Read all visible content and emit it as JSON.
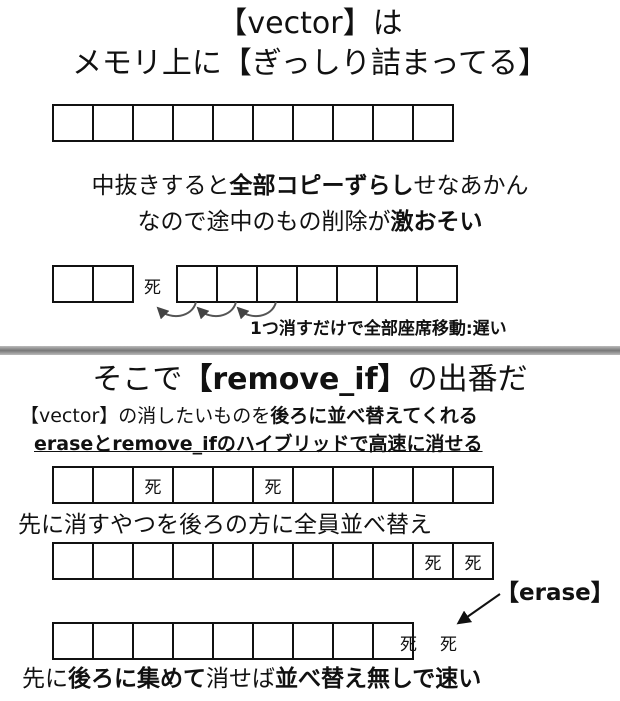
{
  "top": {
    "title_line1": "【vector】は",
    "title_line2": "メモリ上に【ぎっしり詰まってる】",
    "desc1": {
      "a": "中抜きすると",
      "b": "全部コピーずらし",
      "c": "せなあかん"
    },
    "desc2": {
      "a": "なので途中のもの削除が",
      "b": "激おそい"
    },
    "dead_mark": "死",
    "shift_note": "1つ消すだけで全部座席移動:遅い"
  },
  "bottom": {
    "title": {
      "a": "そこで",
      "b": "【remove_if】",
      "c": "の出番だ"
    },
    "line1": {
      "a": "【vector】の消したいものを",
      "b": "後ろに並べ替えてくれる"
    },
    "line2": "eraseとremove_ifのハイブリッドで高速に消せる",
    "step1_cells": [
      "",
      "",
      "死",
      "",
      "",
      "死",
      "",
      "",
      "",
      "",
      ""
    ],
    "step1_caption": "先に消すやつを後ろの方に全員並べ替え",
    "step2_cells": [
      "",
      "",
      "",
      "",
      "",
      "",
      "",
      "",
      "",
      "死",
      "死"
    ],
    "erase_label": "【erase】",
    "step3_cells": [
      "",
      "",
      "",
      "",
      "",
      "",
      "",
      "",
      ""
    ],
    "step3_marks": [
      "死",
      "死"
    ],
    "conclusion": {
      "a": "先に",
      "b": "後ろに集めて",
      "c": "消せば",
      "d": "並べ替え無しで速い"
    }
  }
}
